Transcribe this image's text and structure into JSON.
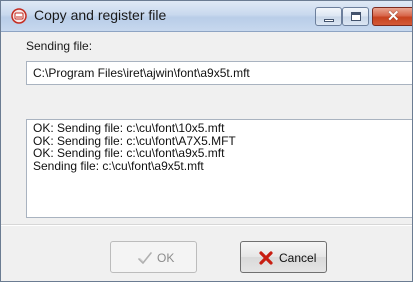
{
  "window": {
    "title": "Copy and register file",
    "icon": "app-icon",
    "controls": {
      "minimize": "minimize-icon",
      "maximize": "maximize-icon",
      "close": "close-icon"
    }
  },
  "form": {
    "label": "Sending file:",
    "path": "C:\\Program Files\\iret\\ajwin\\font\\a9x5t.mft"
  },
  "log": {
    "lines": [
      "OK: Sending file: c:\\cu\\font\\10x5.mft",
      "OK: Sending file: c:\\cu\\font\\A7X5.MFT",
      "OK: Sending file: c:\\cu\\font\\a9x5.mft",
      "Sending file: c:\\cu\\font\\a9x5t.mft"
    ]
  },
  "buttons": {
    "ok": {
      "label": "OK",
      "icon": "checkmark-icon",
      "enabled": false
    },
    "cancel": {
      "label": "Cancel",
      "icon": "red-x-icon",
      "enabled": true
    }
  },
  "colors": {
    "titlebar": "#c9d9ee",
    "close_button": "#c7421f",
    "cancel_icon": "#c81e12",
    "dialog_bg": "#f0f0f0"
  }
}
